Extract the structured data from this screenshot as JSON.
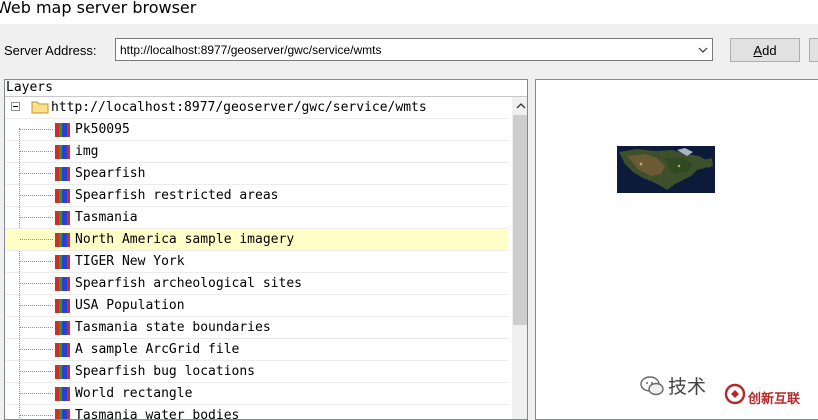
{
  "window": {
    "title": "Web map server browser"
  },
  "server": {
    "label": "Server Address:",
    "address": "http://localhost:8977/geoserver/gwc/service/wmts",
    "add_label_accel": "A",
    "add_label_rest": "dd"
  },
  "layers": {
    "header": "Layers",
    "root": "http://localhost:8977/geoserver/gwc/service/wmts",
    "items": [
      {
        "name": "Pk50095",
        "selected": false
      },
      {
        "name": "img",
        "selected": false
      },
      {
        "name": "Spearfish",
        "selected": false
      },
      {
        "name": "Spearfish restricted areas",
        "selected": false
      },
      {
        "name": "Tasmania",
        "selected": false
      },
      {
        "name": "North America sample imagery",
        "selected": true
      },
      {
        "name": "TIGER New York",
        "selected": false
      },
      {
        "name": "Spearfish archeological sites",
        "selected": false
      },
      {
        "name": "USA Population",
        "selected": false
      },
      {
        "name": "Tasmania state boundaries",
        "selected": false
      },
      {
        "name": "A sample ArcGrid file",
        "selected": false
      },
      {
        "name": "Spearfish bug locations",
        "selected": false
      },
      {
        "name": "World rectangle",
        "selected": false
      },
      {
        "name": "Tasmania water bodies",
        "selected": false
      }
    ]
  },
  "watermark": {
    "text": "技术",
    "logo_text": "创新互联"
  },
  "colors": {
    "selected_row": "#ffffc8",
    "layer_icon": [
      "#d42a2a",
      "#2a9a2a",
      "#2a3fd4"
    ],
    "folder": "#ffe08a"
  },
  "icons": {
    "folder": "folder-icon",
    "layer": "layer-icon",
    "expander": "tree-collapse-icon",
    "combo": "chevron-down-icon",
    "scroll": "scroll-up-icon"
  }
}
